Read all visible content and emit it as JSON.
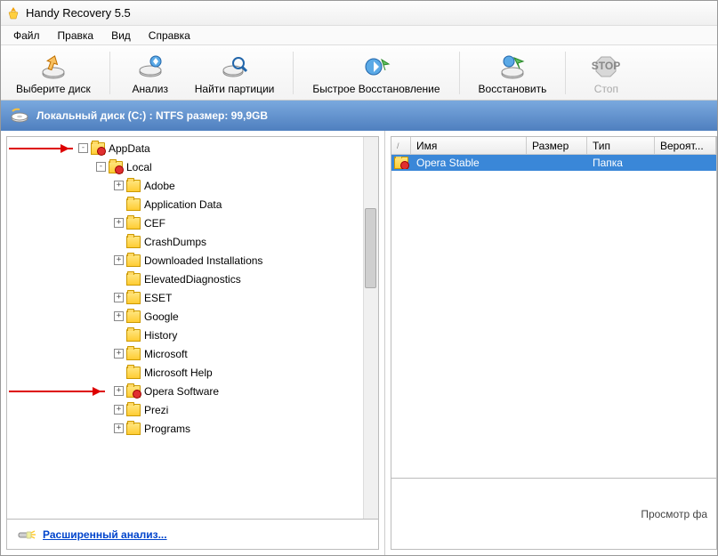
{
  "window": {
    "title": "Handy Recovery 5.5"
  },
  "menu": {
    "file": "Файл",
    "edit": "Правка",
    "view": "Вид",
    "help": "Справка"
  },
  "toolbar": {
    "select_disk": "Выберите диск",
    "analyze": "Анализ",
    "find_partitions": "Найти партиции",
    "quick_restore": "Быстрое Восстановление",
    "restore": "Восстановить",
    "stop": "Стоп"
  },
  "disk_header": "Локальный диск (C:) : NTFS размер: 99,9GB",
  "tree": [
    {
      "depth": 0,
      "exp": "-",
      "red": true,
      "label": "AppData"
    },
    {
      "depth": 1,
      "exp": "-",
      "red": true,
      "label": "Local"
    },
    {
      "depth": 2,
      "exp": "+",
      "red": false,
      "label": "Adobe"
    },
    {
      "depth": 2,
      "exp": "",
      "red": false,
      "label": "Application Data"
    },
    {
      "depth": 2,
      "exp": "+",
      "red": false,
      "label": "CEF"
    },
    {
      "depth": 2,
      "exp": "",
      "red": false,
      "label": "CrashDumps"
    },
    {
      "depth": 2,
      "exp": "+",
      "red": false,
      "label": "Downloaded Installations"
    },
    {
      "depth": 2,
      "exp": "",
      "red": false,
      "label": "ElevatedDiagnostics"
    },
    {
      "depth": 2,
      "exp": "+",
      "red": false,
      "label": "ESET"
    },
    {
      "depth": 2,
      "exp": "+",
      "red": false,
      "label": "Google"
    },
    {
      "depth": 2,
      "exp": "",
      "red": false,
      "label": "History"
    },
    {
      "depth": 2,
      "exp": "+",
      "red": false,
      "label": "Microsoft"
    },
    {
      "depth": 2,
      "exp": "",
      "red": false,
      "label": "Microsoft Help"
    },
    {
      "depth": 2,
      "exp": "+",
      "red": true,
      "label": "Opera Software"
    },
    {
      "depth": 2,
      "exp": "+",
      "red": false,
      "label": "Prezi"
    },
    {
      "depth": 2,
      "exp": "+",
      "red": false,
      "label": "Programs"
    }
  ],
  "advanced_link": "Расширенный анализ...",
  "columns": {
    "name": "Имя",
    "size": "Размер",
    "type": "Тип",
    "prob": "Вероят..."
  },
  "rows": [
    {
      "name": "Opera Stable",
      "size": "",
      "type": "Папка",
      "selected": true
    }
  ],
  "preview_label": "Просмотр фа"
}
